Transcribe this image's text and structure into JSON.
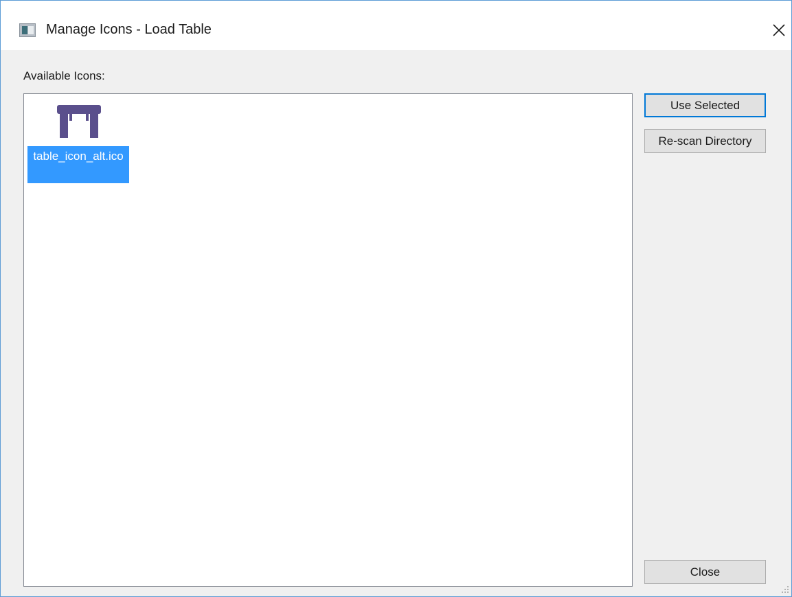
{
  "window": {
    "title": "Manage Icons - Load Table",
    "close_glyph": "✕"
  },
  "available": {
    "label": "Available Icons:",
    "items": [
      {
        "name": "table_icon_alt.ico",
        "icon": "table-icon",
        "selected": true
      }
    ]
  },
  "buttons": {
    "use_selected": "Use Selected",
    "rescan": "Re-scan Directory",
    "close": "Close"
  },
  "colors": {
    "selection": "#3399ff",
    "table_icon": "#5a4f8c",
    "focus_border": "#0078d7"
  }
}
